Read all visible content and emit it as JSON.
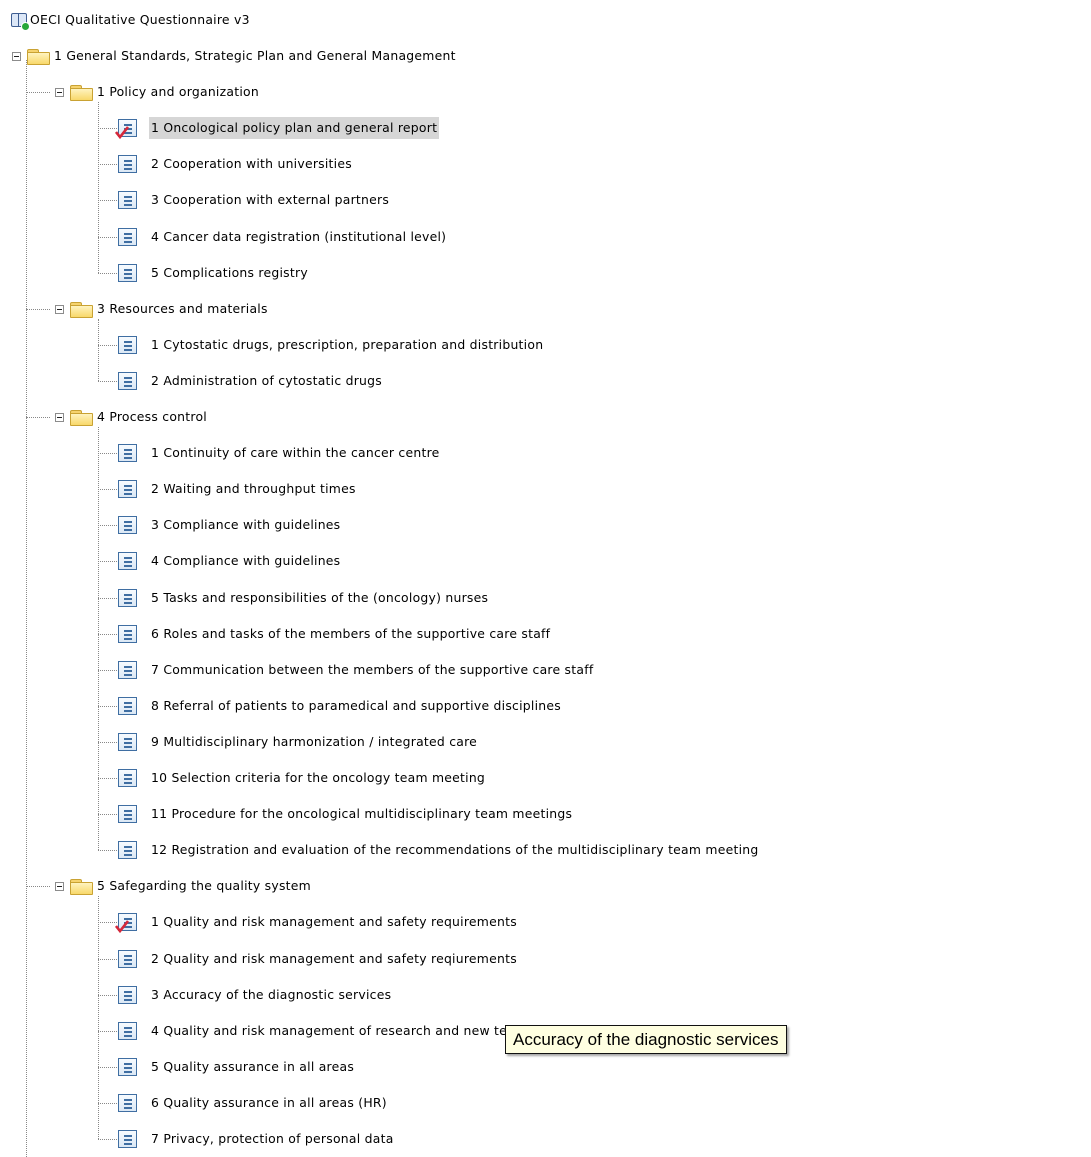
{
  "root": {
    "label": "OECI Qualitative Questionnaire v3"
  },
  "chapter": {
    "label": "1 General Standards, Strategic Plan and General Management",
    "sections": [
      {
        "label": "1 Policy and organization",
        "items": [
          {
            "label": "1 Oncological policy plan and general report",
            "checked": true,
            "selected": true
          },
          {
            "label": "2 Cooperation with universities"
          },
          {
            "label": "3 Cooperation with external partners"
          },
          {
            "label": "4 Cancer data registration (institutional level)"
          },
          {
            "label": "5 Complications registry"
          }
        ]
      },
      {
        "label": "3 Resources and materials",
        "items": [
          {
            "label": "1 Cytostatic drugs, prescription, preparation and distribution"
          },
          {
            "label": "2 Administration of cytostatic drugs"
          }
        ]
      },
      {
        "label": "4 Process control",
        "items": [
          {
            "label": "1 Continuity of care within the cancer centre"
          },
          {
            "label": "2 Waiting and throughput times"
          },
          {
            "label": "3 Compliance with guidelines"
          },
          {
            "label": "4 Compliance with guidelines"
          },
          {
            "label": "5 Tasks and responsibilities of the (oncology) nurses"
          },
          {
            "label": "6 Roles and tasks of the members of the supportive care staff"
          },
          {
            "label": "7 Communication between the members of the supportive care staff"
          },
          {
            "label": "8 Referral of patients to paramedical and supportive disciplines"
          },
          {
            "label": "9 Multidisciplinary harmonization / integrated care"
          },
          {
            "label": "10 Selection criteria for the oncology team meeting"
          },
          {
            "label": "11 Procedure for the oncological multidisciplinary team meetings"
          },
          {
            "label": "12 Registration and evaluation of the recommendations of the multidisciplinary team meeting"
          }
        ]
      },
      {
        "label": "5 Safegarding the quality system",
        "items": [
          {
            "label": "1 Quality and risk management and safety requirements",
            "checked": true
          },
          {
            "label": "2 Quality and risk management and safety reqiurements"
          },
          {
            "label": "3 Accuracy of the diagnostic services"
          },
          {
            "label": "4 Quality and risk management of research and new techniques"
          },
          {
            "label": "5 Quality assurance in all areas"
          },
          {
            "label": "6 Quality assurance in all areas (HR)"
          },
          {
            "label": "7 Privacy, protection of personal data"
          }
        ]
      }
    ]
  },
  "tooltip": {
    "text": "Accuracy of the diagnostic services"
  },
  "icons": {
    "root": "book-icon",
    "expander": "collapse-minus-icon",
    "folder": "folder-open-icon",
    "item": "document-icon",
    "checked_item": "checked-document-icon"
  },
  "colors": {
    "selection": "#d6d6d6",
    "tooltip_bg": "#ffffe1",
    "check": "#d6283a"
  }
}
